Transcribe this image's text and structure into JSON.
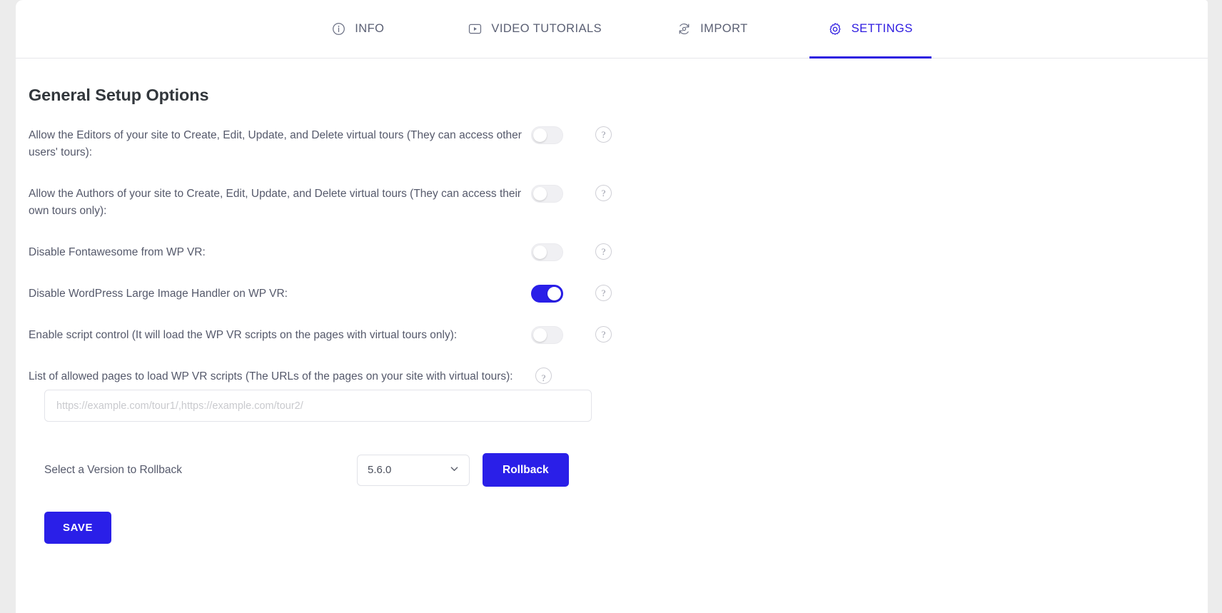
{
  "tabs": [
    {
      "id": "info",
      "label": "INFO",
      "icon": "info-circle-icon",
      "active": false
    },
    {
      "id": "video-tutorials",
      "label": "VIDEO TUTORIALS",
      "icon": "video-play-icon",
      "active": false
    },
    {
      "id": "import",
      "label": "IMPORT",
      "icon": "import-sync-icon",
      "active": false
    },
    {
      "id": "settings",
      "label": "SETTINGS",
      "icon": "gear-icon",
      "active": true
    }
  ],
  "page": {
    "title": "General Setup Options"
  },
  "options": [
    {
      "label": "Allow the Editors of your site to Create, Edit, Update, and Delete virtual tours (They can access other users' tours):",
      "toggle": "off",
      "help": "?"
    },
    {
      "label": "Allow the Authors of your site to Create, Edit, Update, and Delete virtual tours (They can access their own tours only):",
      "toggle": "off",
      "help": "?"
    },
    {
      "label": "Disable Fontawesome from WP VR:",
      "toggle": "off",
      "help": "?"
    },
    {
      "label": "Disable WordPress Large Image Handler on WP VR:",
      "toggle": "on",
      "help": "?"
    },
    {
      "label": "Enable script control (It will load the WP VR scripts on the pages with virtual tours only):",
      "toggle": "off",
      "help": "?"
    }
  ],
  "allowed_pages": {
    "label": "List of allowed pages to load WP VR scripts (The URLs of the pages on your site with virtual tours):",
    "help": "?",
    "value": "",
    "placeholder": "https://example.com/tour1/,https://example.com/tour2/"
  },
  "rollback": {
    "label": "Select a Version to Rollback",
    "selected_version": "5.6.0",
    "button_label": "Rollback"
  },
  "save": {
    "label": "SAVE"
  },
  "colors": {
    "accent": "#2a1fe8",
    "text": "#55596b",
    "title": "#32373c",
    "tab_inactive": "#5a5f73",
    "page_background": "#ececec",
    "card_background": "#ffffff"
  }
}
